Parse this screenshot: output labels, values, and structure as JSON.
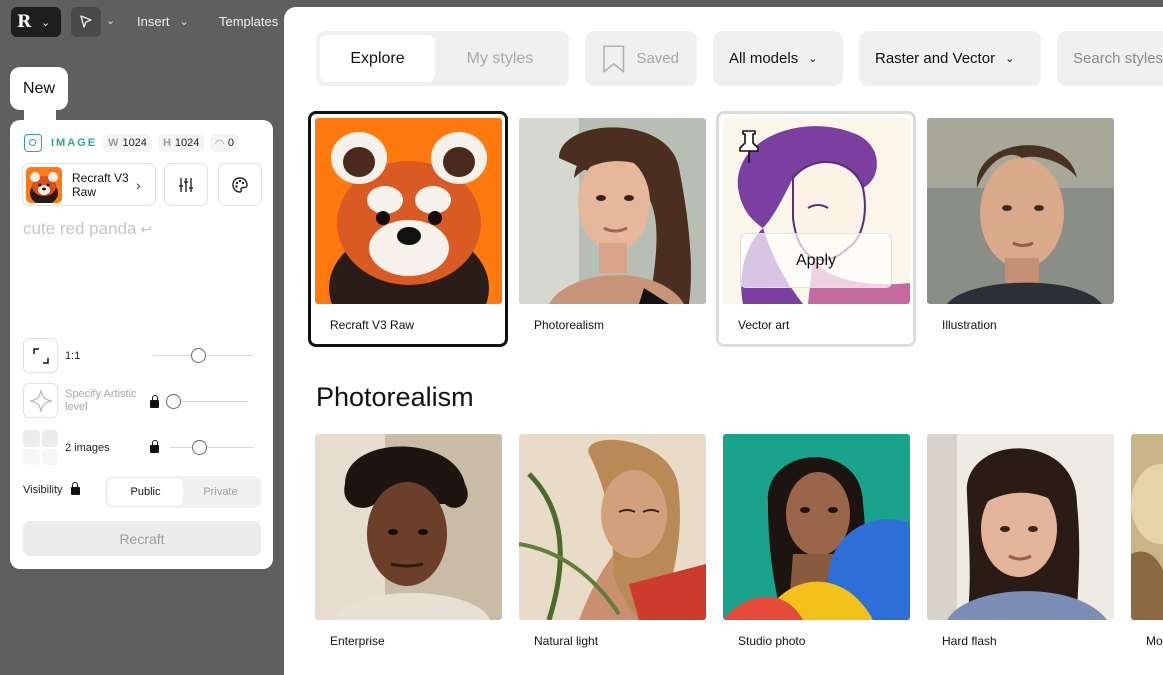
{
  "toolbar": {
    "insert_label": "Insert",
    "templates_label": "Templates"
  },
  "panel": {
    "new_label": "New",
    "image_label": "IMAGE",
    "width_key": "W",
    "width_value": "1024",
    "height_key": "H",
    "height_value": "1024",
    "corner_value": "0",
    "model_name": "Recraft V3 Raw",
    "prompt": "cute red panda",
    "aspect_label": "1:1",
    "artistic_label": "Specify Artistic level",
    "images_label": "2 images",
    "visibility_label": "Visibility",
    "public_label": "Public",
    "private_label": "Private",
    "recraft_label": "Recraft"
  },
  "browser": {
    "tabs": [
      {
        "label": "Explore"
      },
      {
        "label": "My styles"
      }
    ],
    "saved_label": "Saved",
    "models_label": "All models",
    "format_label": "Raster and Vector",
    "search_placeholder": "Search styles",
    "apply_label": "Apply",
    "top_styles": [
      {
        "label": "Recraft V3 Raw"
      },
      {
        "label": "Photorealism"
      },
      {
        "label": "Vector art"
      },
      {
        "label": "Illustration"
      }
    ],
    "section_title": "Photorealism",
    "photo_styles": [
      {
        "label": "Enterprise"
      },
      {
        "label": "Natural light"
      },
      {
        "label": "Studio photo"
      },
      {
        "label": "Hard flash"
      },
      {
        "label": "Mo"
      }
    ]
  },
  "colors": {
    "accent_teal": "#2aa79b",
    "panda_orange": "#ff7a12"
  }
}
